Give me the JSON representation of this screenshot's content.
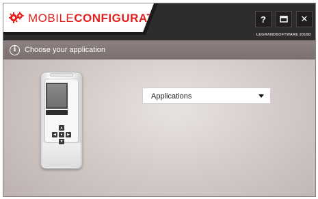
{
  "app": {
    "brand_light": "MOBILE",
    "brand_bold": "CONFIGURATOR",
    "version": "LEGRANDSOFTWARE 2015D",
    "accent_color": "#e3201b",
    "logo_icon": "gear-logo-icon"
  },
  "window_controls": {
    "help_label": "?",
    "close_label": "✕"
  },
  "subtitle": {
    "text": "Choose your application",
    "icon": "info-icon"
  },
  "device": {
    "icon": "remote-programmer-device-image",
    "keys": [
      "▲",
      "◀",
      "●",
      "▶",
      "▼"
    ]
  },
  "dropdown": {
    "selected": "Applications",
    "icon": "caret-down-icon"
  }
}
